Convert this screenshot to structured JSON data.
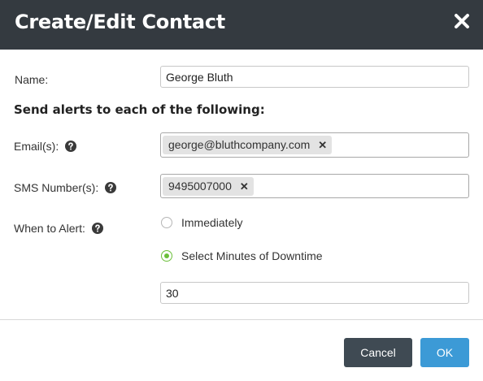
{
  "dialog": {
    "title": "Create/Edit Contact"
  },
  "form": {
    "name_label": "Name:",
    "name_value": "George Bluth",
    "section_title": "Send alerts to each of the following:",
    "emails_label": "Email(s):",
    "emails": [
      "george@bluthcompany.com"
    ],
    "sms_label": "SMS Number(s):",
    "sms_numbers": [
      "9495007000"
    ],
    "when_label": "When to Alert:",
    "when_options": [
      {
        "label": "Immediately",
        "selected": false
      },
      {
        "label": "Select Minutes of Downtime",
        "selected": true
      }
    ],
    "minutes_value": "30"
  },
  "footer": {
    "cancel_label": "Cancel",
    "ok_label": "OK"
  },
  "colors": {
    "header_bg": "#343a40",
    "ok_button": "#3c9ad6",
    "cancel_button": "#3f4a53",
    "radio_selected": "#6bbf3a"
  },
  "icons": {
    "close": "close-icon",
    "help": "question-circle-icon",
    "tag_remove": "x-icon"
  }
}
